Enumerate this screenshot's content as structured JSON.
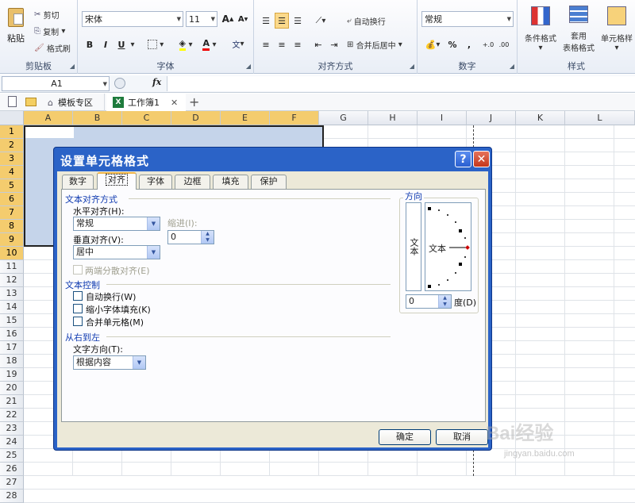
{
  "ribbon": {
    "clipboard": {
      "paste": "粘贴",
      "cut": "剪切",
      "copy": "复制",
      "format_painter": "格式刷",
      "label": "剪贴板"
    },
    "font": {
      "name": "宋体",
      "size": "11",
      "bold": "B",
      "italic": "I",
      "underline": "U",
      "label": "字体"
    },
    "alignment": {
      "wrap": "自动换行",
      "merge": "合并后居中",
      "label": "对齐方式"
    },
    "number": {
      "format": "常规",
      "percent": "%",
      "comma": ",",
      "label": "数字"
    },
    "styles": {
      "conditional": "条件格式",
      "table_line1": "套用",
      "table_line2": "表格格式",
      "cell": "单元格样",
      "label": "样式"
    }
  },
  "formula_bar": {
    "name_box": "A1",
    "fx": "fx"
  },
  "tabs": [
    {
      "label": "模板专区"
    },
    {
      "label": "工作簿1"
    }
  ],
  "grid": {
    "columns": [
      "A",
      "B",
      "C",
      "D",
      "E",
      "F",
      "G",
      "H",
      "I",
      "J",
      "K",
      "L"
    ],
    "rows": [
      "1",
      "2",
      "3",
      "4",
      "5",
      "6",
      "7",
      "8",
      "9",
      "10",
      "11",
      "12",
      "13",
      "14",
      "15",
      "16",
      "17",
      "18",
      "19",
      "20",
      "21",
      "22",
      "23",
      "24",
      "25",
      "26",
      "27",
      "28"
    ]
  },
  "dialog": {
    "title": "设置单元格格式",
    "help": "?",
    "close": "✕",
    "tabs": [
      "数字",
      "对齐",
      "字体",
      "边框",
      "填充",
      "保护"
    ],
    "text_alignment": "文本对齐方式",
    "horizontal_label": "水平对齐(H):",
    "horizontal_value": "常规",
    "indent_label": "缩进(I):",
    "indent_value": "0",
    "vertical_label": "垂直对齐(V):",
    "vertical_value": "居中",
    "justify_distributed": "两端分散对齐(E)",
    "text_control": "文本控制",
    "wrap_text": "自动换行(W)",
    "shrink_to_fit": "缩小字体填充(K)",
    "merge_cells": "合并单元格(M)",
    "rtl": "从右到左",
    "direction_label": "文字方向(T):",
    "direction_value": "根据内容",
    "orientation": "方向",
    "vertical_text": "文本",
    "dial_text": "文本",
    "degree_value": "0",
    "degree_label": "度(D)",
    "ok": "确定",
    "cancel": "取消"
  },
  "watermark": {
    "brand": "Bai经验",
    "url": "jingyan.baidu.com"
  },
  "colors": {
    "selection": "#c5d4ea",
    "dialog_title": "#2b63c7",
    "active_tab": "#f0b64a"
  }
}
